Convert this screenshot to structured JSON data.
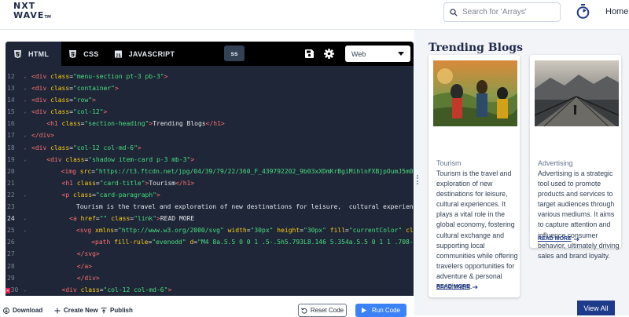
{
  "header": {
    "logo_line1": "NXT",
    "logo_line2": "WAVE",
    "logo_tm": "TM",
    "search_placeholder": "Search for 'Arrays'",
    "home_label": "Home"
  },
  "editor": {
    "tabs": [
      {
        "label": "HTML",
        "icon": "html5-icon",
        "active": true
      },
      {
        "label": "CSS",
        "icon": "css3-icon",
        "active": false
      },
      {
        "label": "JAVASCRIPT",
        "icon": "js-icon",
        "active": false
      }
    ],
    "ss_label": "ss",
    "view_select": "Web",
    "lines": [
      {
        "n": "12",
        "fold": true,
        "html": "<span class='tg'>&lt;div</span> <span class='at'>class</span>=<span class='st'>\"menu-section pt-3 pb-3\"</span><span class='tg'>&gt;</span>"
      },
      {
        "n": "13",
        "fold": true,
        "html": "<span class='tg'>&lt;div</span> <span class='at'>class</span>=<span class='st'>\"container\"</span><span class='tg'>&gt;</span>"
      },
      {
        "n": "14",
        "fold": true,
        "html": "<span class='tg'>&lt;div</span> <span class='at'>class</span>=<span class='st'>\"row\"</span><span class='tg'>&gt;</span>"
      },
      {
        "n": "15",
        "fold": true,
        "html": "<span class='tg'>&lt;div</span> <span class='at'>class</span>=<span class='st'>\"col-12\"</span><span class='tg'>&gt;</span>"
      },
      {
        "n": "16",
        "fold": false,
        "html": "    <span class='tg'>&lt;h1</span> <span class='at'>class</span>=<span class='st'>\"section-heading\"</span><span class='tg'>&gt;</span>Trending Blogs<span class='tg'>&lt;/h1&gt;</span>"
      },
      {
        "n": "17",
        "fold": true,
        "html": "<span class='tg'>&lt;/div&gt;</span>"
      },
      {
        "n": "18",
        "fold": true,
        "html": "<span class='tg'>&lt;div</span> <span class='at'>class</span>=<span class='st'>\"col-12 col-md-6\"</span><span class='tg'>&gt;</span>"
      },
      {
        "n": "19",
        "fold": true,
        "html": "    <span class='tg'>&lt;div</span> <span class='at'>class</span>=<span class='st'>\"shadow item-card p-3 mb-3\"</span><span class='tg'>&gt;</span>"
      },
      {
        "n": "20",
        "fold": false,
        "html": "        <span class='tg'>&lt;img</span> <span class='at'>src</span>=<span class='st'>\"https://t3.ftcdn.net/jpg/04/39/79/22/360_F_439792202_9b03xXDmKrBgiMihlnFXBjpOumJ5m0lm.</span>"
      },
      {
        "n": "21",
        "fold": false,
        "html": "        <span class='tg'>&lt;h1</span> <span class='at'>class</span>=<span class='st'>\"card-title\"</span><span class='tg'>&gt;</span>Tourism<span class='tg'>&lt;/h1&gt;</span>"
      },
      {
        "n": "22",
        "fold": true,
        "html": "        <span class='tg'>&lt;p</span> <span class='at'>class</span>=<span class='st'>\"card-paragraph\"</span><span class='tg'>&gt;</span>"
      },
      {
        "n": "23",
        "fold": false,
        "html": "            Tourism is the travel and exploration of new destinations for leisure,  cultural experiences"
      },
      {
        "n": "24",
        "fold": true,
        "hl": true,
        "html": "          <span class='tg'>&lt;a</span> <span class='at'>href</span>=<span class='st'>\"\"</span> <span class='at'>class</span>=<span class='st'>\"link\"</span><span class='tg'>&gt;</span>READ MORE"
      },
      {
        "n": "25",
        "fold": true,
        "html": "            <span class='tg'>&lt;svg</span> <span class='at'>xmlns</span>=<span class='st'>\"http://www.w3.org/2000/svg\"</span> <span class='at'>width</span>=<span class='st'>\"30px\"</span> <span class='at'>height</span>=<span class='st'>\"30px\"</span> <span class='at'>fill</span>=<span class='st'>\"currentColor\"</span> <span class='at'>class</span>"
      },
      {
        "n": "26",
        "fold": false,
        "html": "                <span class='tg'>&lt;path</span> <span class='at'>fill-rule</span>=<span class='st'>\"evenodd\"</span> <span class='at'>d</span>=<span class='st'>\"M4 8a.5.5 0 0 1 .5-.5h5.793L8.146 5.354a.5.5 0 1 1 .708-.70</span>"
      },
      {
        "n": "27",
        "fold": false,
        "html": "            <span class='tg'>&lt;/svg&gt;</span>"
      },
      {
        "n": "28",
        "fold": false,
        "html": "            <span class='tg'>&lt;/a&gt;</span>"
      },
      {
        "n": "29",
        "fold": false,
        "html": "            <span class='tg'>&lt;/div&gt;</span>"
      },
      {
        "n": "30",
        "fold": true,
        "err": true,
        "html": "        <span class='tg'>&lt;div</span> <span class='at'>class</span>=<span class='st'>\"col-12 col-md-6\"</span><span class='tg'>&gt;</span>"
      }
    ]
  },
  "footer": {
    "download": "Download",
    "create_new": "Create New",
    "publish": "Publish",
    "reset_code": "Reset Code",
    "run_code": "Run Code"
  },
  "preview": {
    "heading": "Trending Blogs",
    "cards": [
      {
        "title": "Tourism",
        "paragraph": "Tourism is the travel and exploration of new destinations for leisure, cultural experiences. It plays a vital role in the global economy, fostering cultural exchange and supporting local communities while offering travelers opportunities for adventure & personal enrichment.",
        "read_more": "READ MORE"
      },
      {
        "title": "Advertising",
        "paragraph": "Advertising is a strategic tool used to promote products and services to target audiences through various mediums. It aims to capture attention and influence consumer behavior, ultimately driving sales and brand loyalty.",
        "read_more": "READ MORE"
      }
    ],
    "view_all": "View All"
  },
  "colors": {
    "editor_bg": "#1e2637",
    "tabbar_bg": "#000000",
    "brand_navy": "#1e3a8a",
    "run_blue": "#3b82f6"
  }
}
